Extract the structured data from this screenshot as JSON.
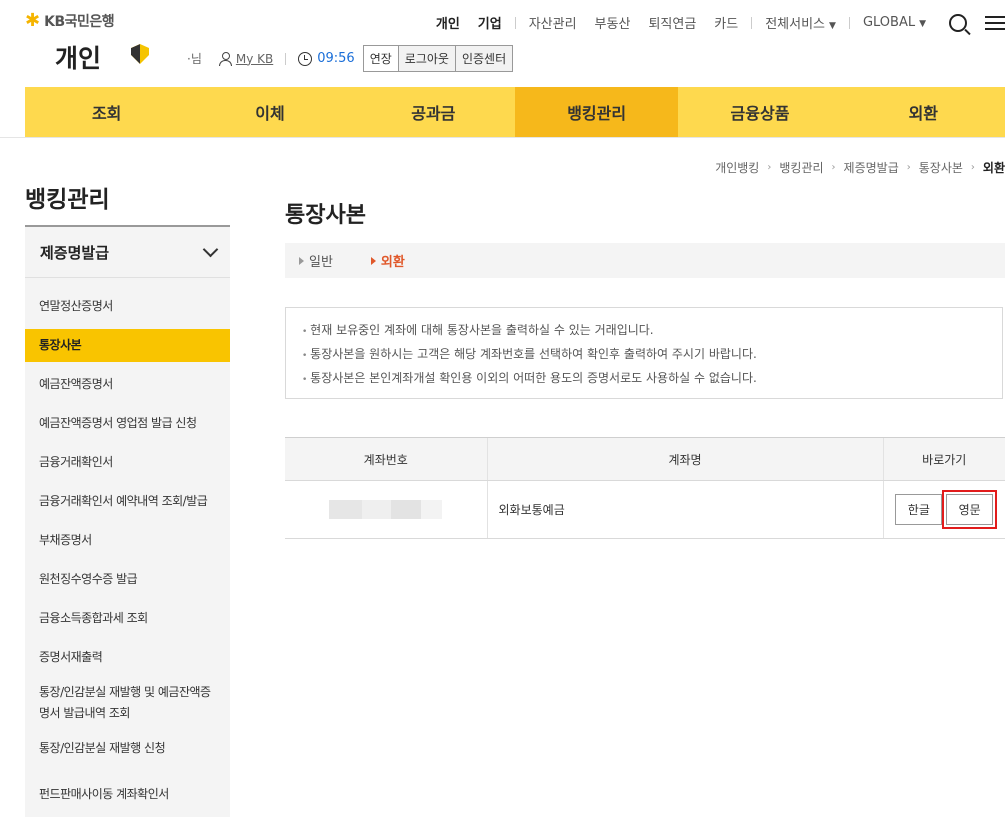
{
  "header": {
    "logo_text": "KB국민은행",
    "brand": "개인",
    "gnb": {
      "primary": [
        "개인",
        "기업"
      ],
      "links": [
        "자산관리",
        "부동산",
        "퇴직연금",
        "카드"
      ],
      "all_services": "전체서비스",
      "global": "GLOBAL"
    },
    "user": {
      "name_suffix": "·님",
      "mykb": "My KB",
      "timer": "09:56",
      "extend": "연장",
      "logout": "로그아웃",
      "cert_center": "인증센터"
    }
  },
  "main_nav": {
    "items": [
      "조회",
      "이체",
      "공과금",
      "뱅킹관리",
      "금융상품",
      "외환"
    ],
    "active_index": 3
  },
  "breadcrumb": {
    "items": [
      "개인뱅킹",
      "뱅킹관리",
      "제증명발급",
      "통장사본"
    ],
    "current": "외환"
  },
  "sidebar": {
    "title": "뱅킹관리",
    "section": "제증명발급",
    "items": [
      "연말정산증명서",
      "통장사본",
      "예금잔액증명서",
      "예금잔액증명서 영업점 발급 신청",
      "금융거래확인서",
      "금융거래확인서 예약내역 조회/발급",
      "부채증명서",
      "원천징수영수증 발급",
      "금융소득종합과세 조회",
      "증명서재출력",
      "통장/인감분실 재발행 및 예금잔액증명서 발급내역 조회",
      "통장/인감분실 재발행 신청",
      "펀드판매사이동 계좌확인서"
    ],
    "active_index": 1
  },
  "content": {
    "title": "통장사본",
    "tabs": [
      "일반",
      "외환"
    ],
    "active_tab": 1,
    "notices": [
      "현재 보유중인 계좌에 대해 통장사본을 출력하실 수 있는 거래입니다.",
      "통장사본을 원하시는 고객은 해당 계좌번호를 선택하여 확인후 출력하여 주시기 바랍니다.",
      "통장사본은 본인계좌개설 확인용 이외의 어떠한 용도의 증명서로도 사용하실 수 없습니다."
    ],
    "table": {
      "headers": [
        "계좌번호",
        "계좌명",
        "바로가기"
      ],
      "rows": [
        {
          "account_name": "외화보통예금",
          "btn_korean": "한글",
          "btn_english": "영문"
        }
      ]
    }
  },
  "colors": {
    "nav_bg": "#fed94e",
    "nav_active": "#f6b81b",
    "sidebar_active": "#f9c400",
    "tab_active": "#e0582a",
    "highlight": "#e21c1c"
  }
}
